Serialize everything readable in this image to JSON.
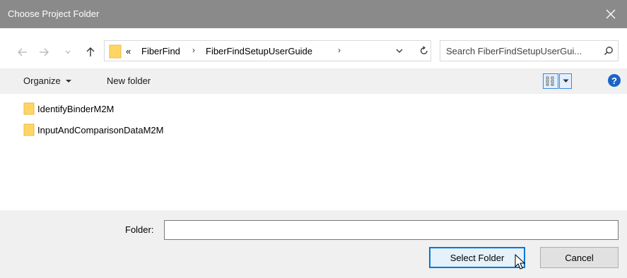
{
  "window": {
    "title": "Choose Project Folder",
    "close_icon": "close-icon"
  },
  "navigation": {
    "back_icon": "arrow-left-icon",
    "forward_icon": "arrow-right-icon",
    "recent_icon": "chevron-down-icon",
    "up_icon": "arrow-up-icon"
  },
  "address": {
    "overflow": "«",
    "crumbs": [
      "FiberFind",
      "FiberFindSetupUserGuide"
    ],
    "separator": "›"
  },
  "search": {
    "placeholder": "Search FiberFindSetupUserGui..."
  },
  "toolbar": {
    "organize_label": "Organize",
    "new_folder_label": "New folder",
    "help_label": "?"
  },
  "files": [
    {
      "name": "IdentifyBinderM2M",
      "type": "folder"
    },
    {
      "name": "InputAndComparisonDataM2M",
      "type": "folder"
    }
  ],
  "footer": {
    "folder_label": "Folder:",
    "folder_value": "",
    "select_label": "Select Folder",
    "cancel_label": "Cancel"
  },
  "colors": {
    "titlebar": "#8a8a8a",
    "panel": "#f0f0f0",
    "folder_yellow": "#ffd664",
    "accent": "#0078d7"
  }
}
